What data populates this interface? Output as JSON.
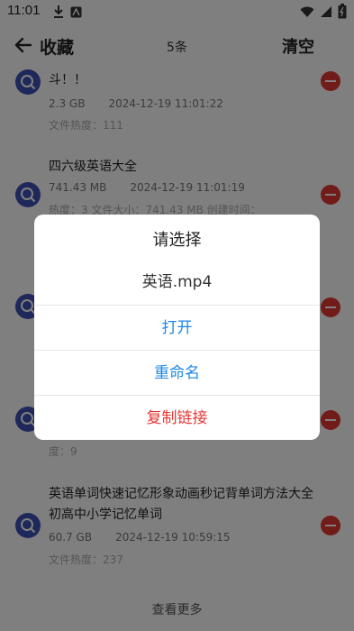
{
  "status_bar": {
    "time": "11:01"
  },
  "header": {
    "title": "收藏",
    "count": "5条",
    "clear_label": "清空"
  },
  "items": [
    {
      "title": "斗！！",
      "size": "2.3 GB",
      "date": "2024-12-19 11:01:22",
      "sub": "文件热度：111"
    },
    {
      "title": "四六级英语大全",
      "size": "741.43 MB",
      "date": "2024-12-19 11:01:19",
      "sub": "热度：3  文件大小：741.43 MB  创建时间："
    },
    {
      "sub": "度：9"
    },
    {
      "title": "英语单词快速记忆形象动画秒记背单词方法大全初高中小学记忆单词",
      "size": "60.7 GB",
      "date": "2024-12-19 10:59:15",
      "sub": "文件热度：237"
    }
  ],
  "more_label": "查看更多",
  "dialog": {
    "title": "请选择",
    "filename": "英语.mp4",
    "options": [
      {
        "label": "打开"
      },
      {
        "label": "重命名"
      },
      {
        "label": "复制链接"
      }
    ]
  }
}
